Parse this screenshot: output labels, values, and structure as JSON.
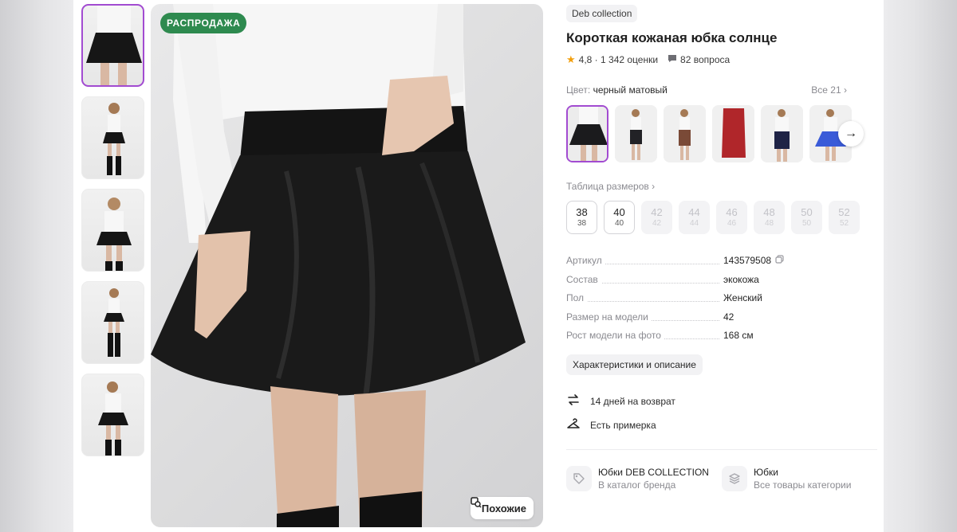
{
  "gallery": {
    "badge": "РАСПРОДАЖА",
    "similar_label": "Похожие",
    "thumbnail_count": 5,
    "active_thumbnail": 1
  },
  "product": {
    "brand": "Deb collection",
    "title": "Короткая кожаная юбка солнце",
    "rating": "4,8",
    "reviews": "1 342 оценки",
    "questions": "82 вопроса",
    "color_label": "Цвет:",
    "color_value": "черный матовый",
    "color_all": "Все 21",
    "color_swatches": [
      {
        "name": "black-leather",
        "skirt": "#1b1b1d"
      },
      {
        "name": "black-pencil",
        "skirt": "#222226"
      },
      {
        "name": "brown",
        "skirt": "#7a4a37"
      },
      {
        "name": "red",
        "skirt": "#b0262a"
      },
      {
        "name": "navy",
        "skirt": "#1e2346"
      },
      {
        "name": "blue",
        "skirt": "#3a5bd8"
      }
    ],
    "size_table_label": "Таблица размеров",
    "sizes": [
      {
        "main": "38",
        "sub": "38",
        "available": true
      },
      {
        "main": "40",
        "sub": "40",
        "available": true
      },
      {
        "main": "42",
        "sub": "42",
        "available": false
      },
      {
        "main": "44",
        "sub": "44",
        "available": false
      },
      {
        "main": "46",
        "sub": "46",
        "available": false
      },
      {
        "main": "48",
        "sub": "48",
        "available": false
      },
      {
        "main": "50",
        "sub": "50",
        "available": false
      },
      {
        "main": "52",
        "sub": "52",
        "available": false
      }
    ],
    "specs": [
      {
        "key": "Артикул",
        "value": "143579508"
      },
      {
        "key": "Состав",
        "value": "экокожа"
      },
      {
        "key": "Пол",
        "value": "Женский"
      },
      {
        "key": "Размер на модели",
        "value": "42"
      },
      {
        "key": "Рост модели на фото",
        "value": "168 см"
      }
    ],
    "characteristics_button": "Характеристики и описание",
    "return_policy": "14 дней на возврат",
    "fitting": "Есть примерка",
    "brand_link": {
      "title": "Юбки DEB COLLECTION",
      "subtitle": "В каталог бренда"
    },
    "category_link": {
      "title": "Юбки",
      "subtitle": "Все товары категории"
    }
  },
  "colors": {
    "accent": "#a24bd1",
    "sale": "#2e8a4f",
    "star": "#f29f0d"
  }
}
